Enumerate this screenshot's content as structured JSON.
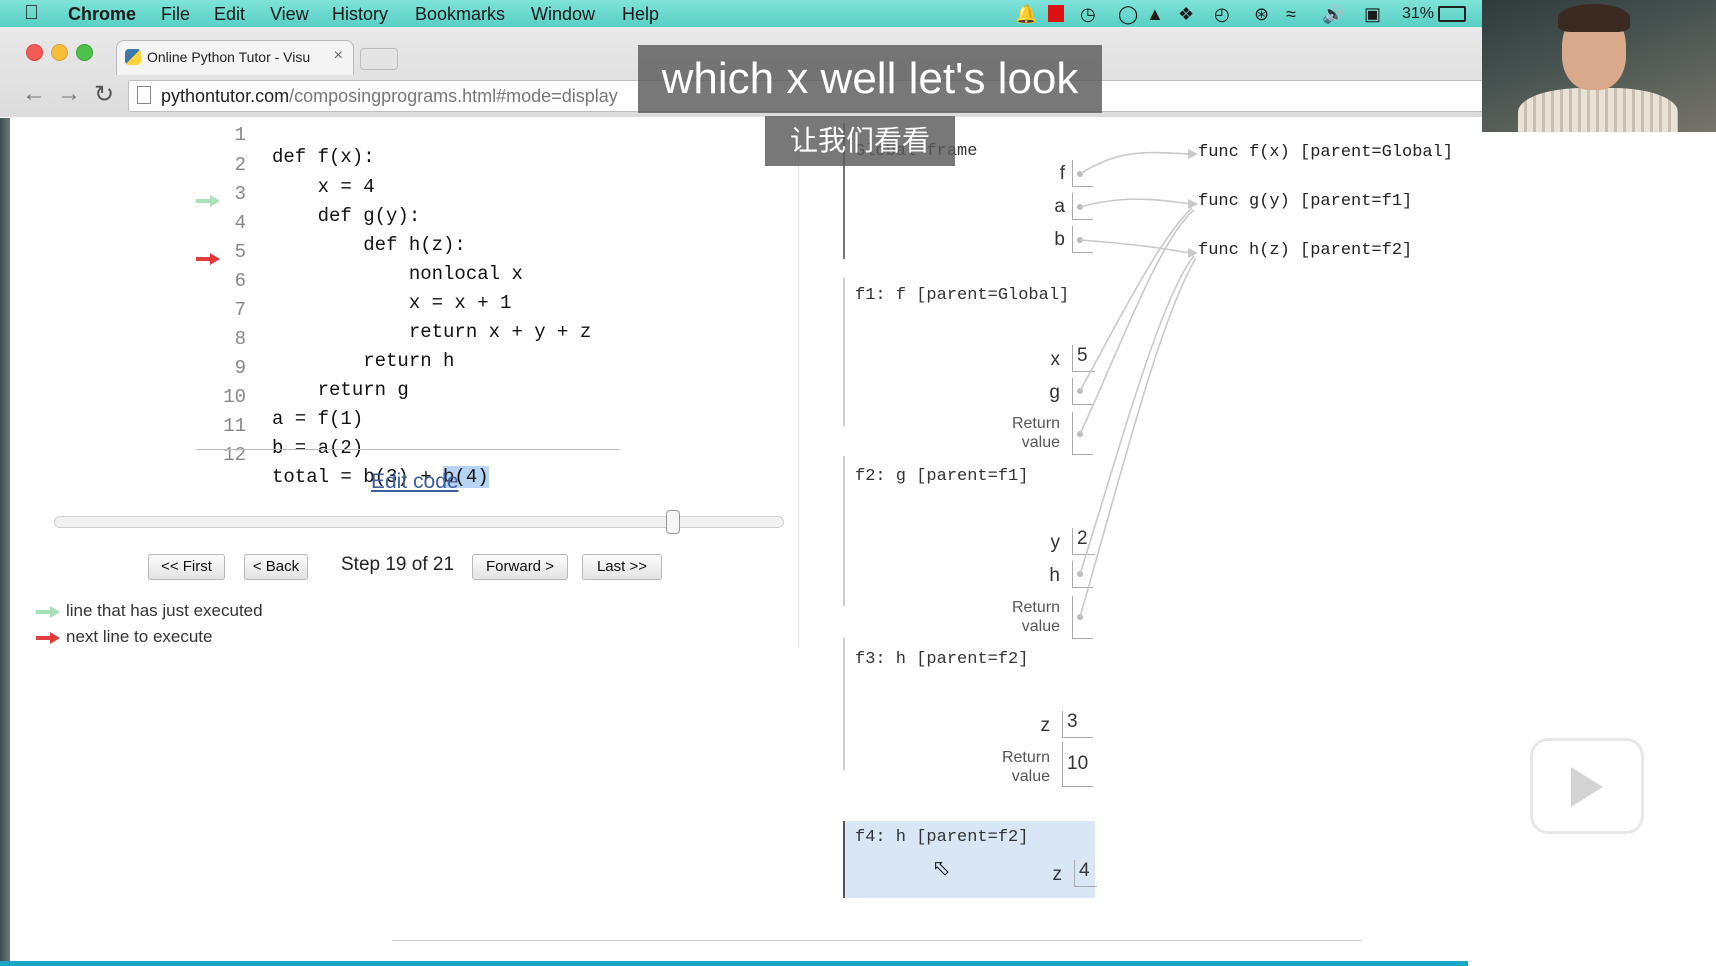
{
  "menubar": {
    "app": "Chrome",
    "items": [
      "File",
      "Edit",
      "View",
      "History",
      "Bookmarks",
      "Window",
      "Help"
    ],
    "battery": "31%"
  },
  "browser": {
    "tab_title": "Online Python Tutor - Visu",
    "tab_close": "×",
    "url_host": "pythontutor.com",
    "url_path": "/composingprograms.html#mode=display"
  },
  "code": {
    "lines": [
      {
        "n": "1",
        "text": "def f(x):"
      },
      {
        "n": "2",
        "text": "    x = 4"
      },
      {
        "n": "3",
        "text": "    def g(y):"
      },
      {
        "n": "4",
        "text": "        def h(z):"
      },
      {
        "n": "5",
        "text": "            nonlocal x"
      },
      {
        "n": "6",
        "text": "            x = x + 1"
      },
      {
        "n": "7",
        "text": "            return x + y + z"
      },
      {
        "n": "8",
        "text": "        return h"
      },
      {
        "n": "9",
        "text": "    return g"
      },
      {
        "n": "10",
        "text": "a = f(1)"
      },
      {
        "n": "11",
        "text": "b = a(2)"
      },
      {
        "n": "12",
        "text": "total = b(3) + ",
        "highlight": "b(4)"
      }
    ],
    "just_executed_line": 4,
    "next_line": 6
  },
  "edit_code_label": "Edit code",
  "controls": {
    "first": "<< First",
    "back": "< Back",
    "step_text": "Step 19 of 21",
    "forward": "Forward >",
    "last": "Last >>",
    "current_step": 19,
    "total_steps": 21
  },
  "legend": {
    "executed": "line that has just executed",
    "next": "next line to execute"
  },
  "frames": {
    "global": {
      "title": "Global frame",
      "vars": [
        "f",
        "a",
        "b"
      ]
    },
    "f1": {
      "title": "f1: f [parent=Global]",
      "vars": [
        {
          "name": "x",
          "value": "5"
        },
        {
          "name": "g",
          "value": ""
        }
      ],
      "return_label": "Return value"
    },
    "f2": {
      "title": "f2: g [parent=f1]",
      "vars": [
        {
          "name": "y",
          "value": "2"
        },
        {
          "name": "h",
          "value": ""
        }
      ],
      "return_label": "Return value"
    },
    "f3": {
      "title": "f3: h [parent=f2]",
      "vars": [
        {
          "name": "z",
          "value": "3"
        }
      ],
      "return_label": "Return value",
      "return_value": "10"
    },
    "f4": {
      "title": "f4: h [parent=f2]",
      "vars": [
        {
          "name": "z",
          "value": "4"
        }
      ]
    }
  },
  "objects": [
    "func f(x) [parent=Global]",
    "func g(y) [parent=f1]",
    "func h(z) [parent=f2]"
  ],
  "subtitles": {
    "en": "which x well let's look",
    "zh": "让我们看看"
  },
  "colors": {
    "executed_arrow": "#a8e0b8",
    "next_arrow": "#e23b3b",
    "highlight": "#b8d4f4",
    "active_frame": "#d8e6f6"
  }
}
